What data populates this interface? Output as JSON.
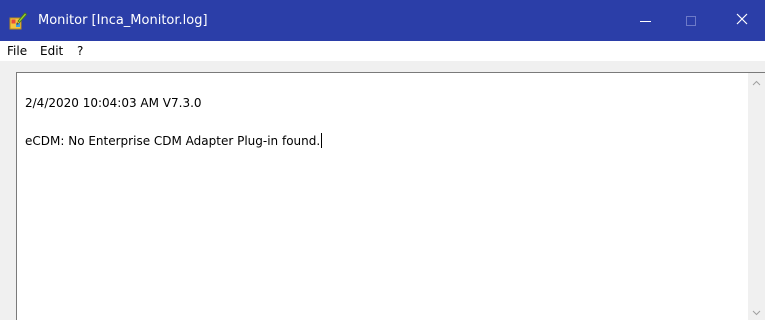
{
  "window": {
    "title": "Monitor [Inca_Monitor.log]",
    "app_icon": "paint-brush-icon",
    "controls": {
      "minimize_icon": "minimize-icon",
      "maximize_icon": "maximize-icon",
      "close_icon": "close-icon",
      "close_label": "✕"
    },
    "titlebar_color": "#2b3ea8"
  },
  "menu": {
    "items": [
      {
        "label": "File"
      },
      {
        "label": "Edit"
      },
      {
        "label": "?"
      }
    ]
  },
  "log": {
    "lines": [
      "2/4/2020 10:04:03 AM V7.3.0",
      "eCDM: No Enterprise CDM Adapter Plug-in found."
    ]
  }
}
